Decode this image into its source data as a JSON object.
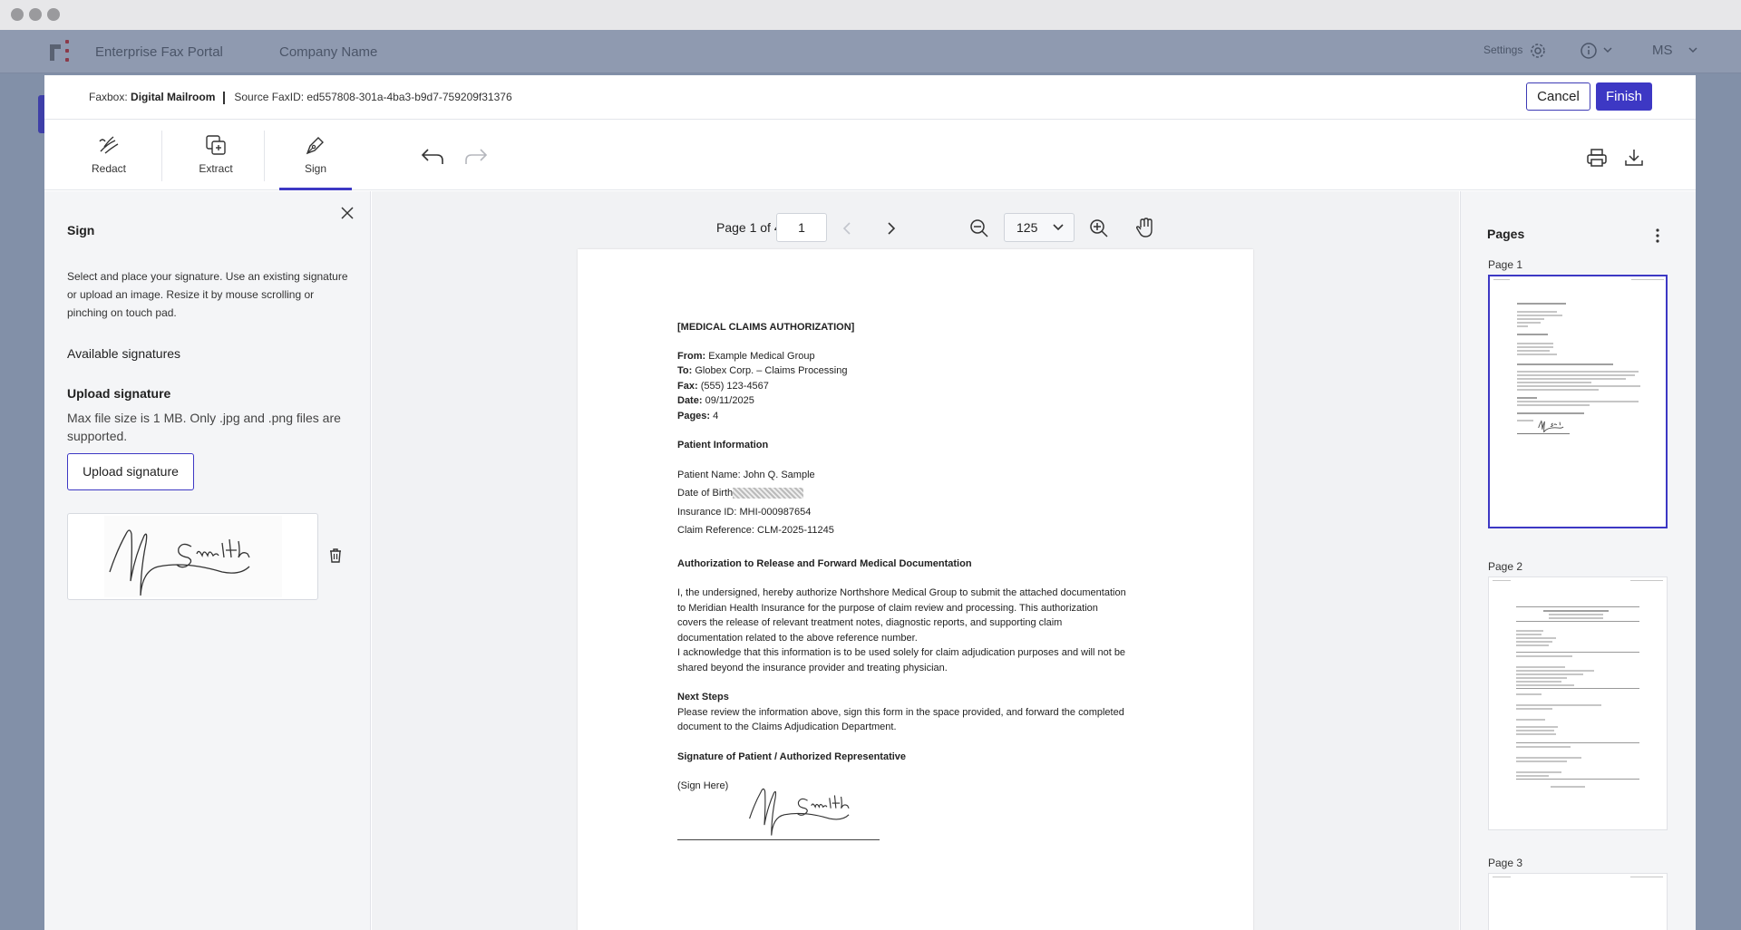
{
  "app": {
    "title": "Enterprise Fax Portal",
    "company": "Company Name",
    "settings_label": "Settings",
    "user_initials": "MS"
  },
  "modal": {
    "faxbox_label": "Faxbox:",
    "faxbox_value": "Digital Mailroom",
    "source_label": "Source FaxID:",
    "source_value": "ed557808-301a-4ba3-b9d7-759209f31376",
    "cancel_label": "Cancel",
    "finish_label": "Finish"
  },
  "toolbar": {
    "tools": [
      {
        "label": "Redact",
        "icon": "redact-icon"
      },
      {
        "label": "Extract",
        "icon": "extract-icon"
      },
      {
        "label": "Sign",
        "icon": "pen-icon",
        "active": true
      }
    ],
    "actions": [
      "undo-icon",
      "redo-icon",
      "print-icon",
      "download-icon"
    ]
  },
  "sign_panel": {
    "title": "Sign",
    "description": "Select and place your signature. Use an existing signature or upload an image. Resize it by mouse scrolling or pinching on touch pad.",
    "available_heading": "Available signatures",
    "upload_heading": "Upload signature",
    "upload_note": "Max file size is 1 MB. Only .jpg and .png files are supported.",
    "upload_button": "Upload signature",
    "signature_image": "M. Smith signature"
  },
  "viewer": {
    "page_label": "Page 1 of 4",
    "page_number": "1",
    "zoom": "125",
    "current_page": 1,
    "total_pages": 4
  },
  "document": {
    "title": "[MEDICAL CLAIMS AUTHORIZATION]",
    "from_label": "From:",
    "from_value": "Example Medical Group",
    "to_label": "To:",
    "to_value": "Globex Corp. – Claims Processing",
    "fax_label": "Fax:",
    "fax_value": "(555) 123-4567",
    "date_label": "Date:",
    "date_value": "09/11/2025",
    "pages_label": "Pages:",
    "pages_value": "4",
    "patient_heading": "Patient Information",
    "patient_name": "Patient Name: John Q. Sample",
    "dob_label": "Date of Birth",
    "insurance_id": "Insurance ID: MHI-000987654",
    "claim_ref": "Claim Reference: CLM-2025-11245",
    "auth_heading": "Authorization to Release and Forward Medical Documentation",
    "auth_line1": "I, the undersigned, hereby authorize Northshore Medical Group to submit the attached documentation",
    "auth_line2": "to Meridian Health Insurance for the purpose of claim review and processing. This authorization",
    "auth_line3": "covers the release of relevant treatment notes, diagnostic reports, and supporting claim",
    "auth_line4": "documentation related to the above reference number.",
    "ack_line1": "I acknowledge that this information is to be used solely for claim adjudication purposes and will not be",
    "ack_line2": "shared beyond the insurance provider and treating physician.",
    "next_heading": "Next Steps",
    "next_line1": "Please review the information above, sign this form in the space provided, and forward the completed",
    "next_line2": "document to the Claims Adjudication Department.",
    "sig_heading": "Signature of Patient / Authorized Representative",
    "sign_here": "(Sign Here)"
  },
  "pages_panel": {
    "title": "Pages",
    "pages": [
      {
        "label": "Page 1",
        "selected": true
      },
      {
        "label": "Page 2"
      },
      {
        "label": "Page 3"
      }
    ]
  },
  "colors": {
    "accent": "#3d38c4",
    "overlay": "#8290a8",
    "panel": "#f4f5f7"
  }
}
